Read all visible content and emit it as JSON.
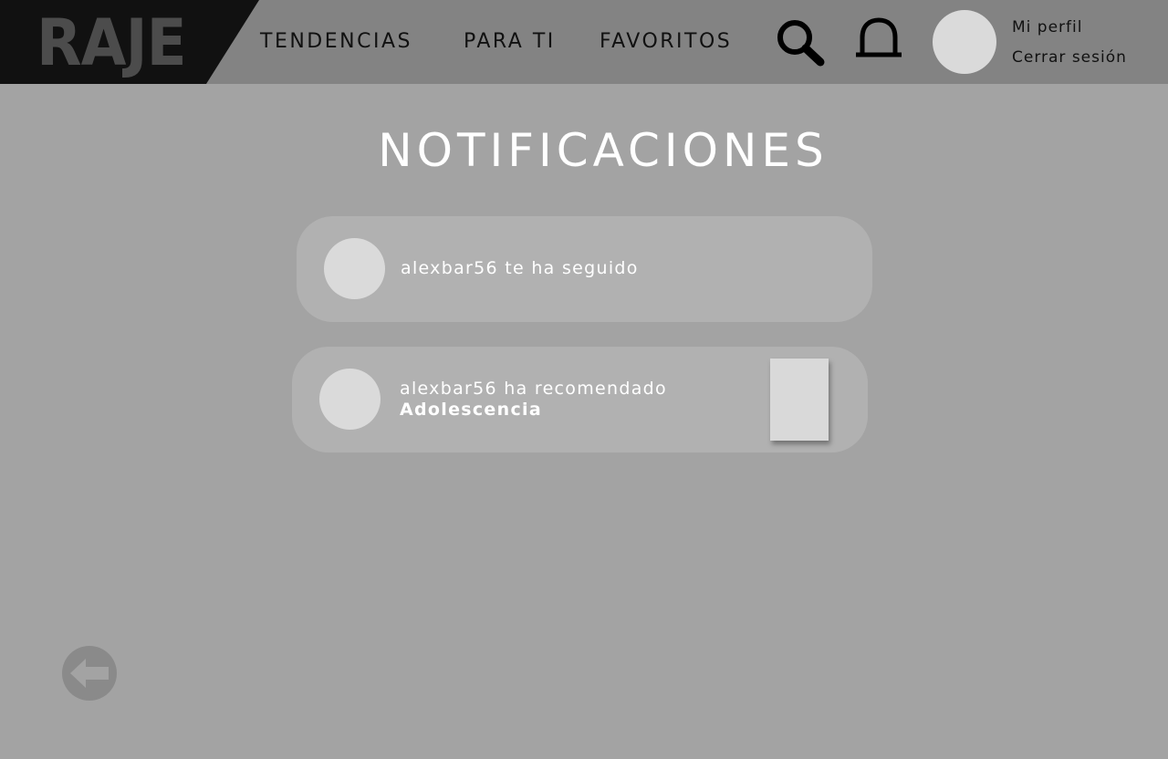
{
  "brand": {
    "logo_text": "RAJE"
  },
  "nav": {
    "items": [
      {
        "label": "TENDENCIAS"
      },
      {
        "label": "PARA TI"
      },
      {
        "label": "FAVORITOS"
      }
    ],
    "search_icon": "search-icon",
    "bell_icon": "bell-icon"
  },
  "profile": {
    "my_profile": "Mi perfil",
    "logout": "Cerrar sesión"
  },
  "page": {
    "title": "NOTIFICACIONES"
  },
  "notifications": [
    {
      "text": "alexbar56 te ha seguido"
    },
    {
      "text": "alexbar56 ha recomendado",
      "title": "Adolescencia"
    }
  ],
  "back_icon": "arrow-left-circle-icon",
  "colors": {
    "background": "#a3a3a3",
    "header": "#838383",
    "logo_band": "#111111",
    "card": "#b1b1b1",
    "placeholder": "#dadada"
  }
}
